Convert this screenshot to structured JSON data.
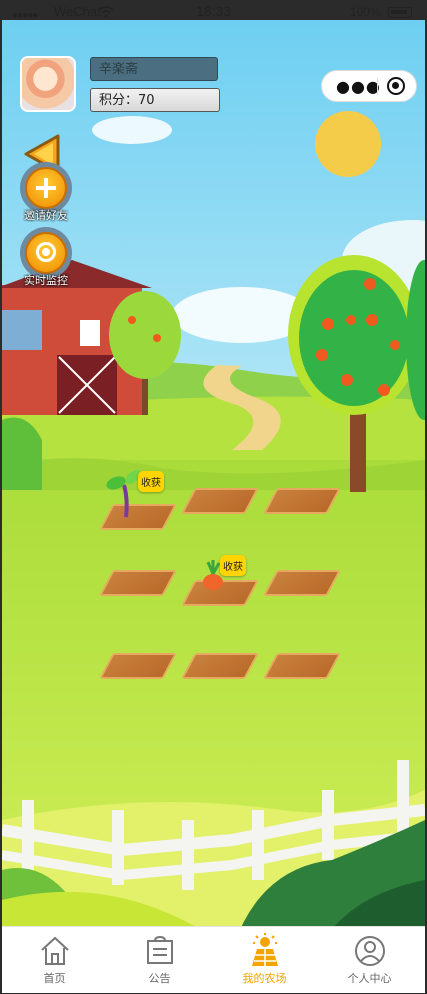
{
  "status_bar": {
    "signal": "●●●●●",
    "carrier": "WeChat",
    "time": "18:33",
    "battery": "100%"
  },
  "user": {
    "name": "辛楽斋",
    "points": "积分：70"
  },
  "side_buttons": {
    "invite": "邀请好友",
    "monitor": "实时监控"
  },
  "plots": [
    {
      "crop": "sprout",
      "action": "收获"
    },
    {
      "crop": "empty",
      "action": ""
    },
    {
      "crop": "empty",
      "action": ""
    },
    {
      "crop": "empty",
      "action": ""
    },
    {
      "crop": "carrot",
      "action": "收获"
    },
    {
      "crop": "empty",
      "action": ""
    },
    {
      "crop": "empty",
      "action": ""
    },
    {
      "crop": "empty",
      "action": ""
    },
    {
      "crop": "empty",
      "action": ""
    }
  ],
  "tabs": [
    {
      "label": "首页",
      "icon": "home-icon",
      "active": false
    },
    {
      "label": "公告",
      "icon": "notice-icon",
      "active": false
    },
    {
      "label": "我的农场",
      "icon": "farm-icon",
      "active": true
    },
    {
      "label": "个人中心",
      "icon": "person-icon",
      "active": false
    }
  ],
  "colors": {
    "accent": "#f5a300",
    "sky": "#7fd3f3",
    "grass": "#c4ea4a"
  }
}
